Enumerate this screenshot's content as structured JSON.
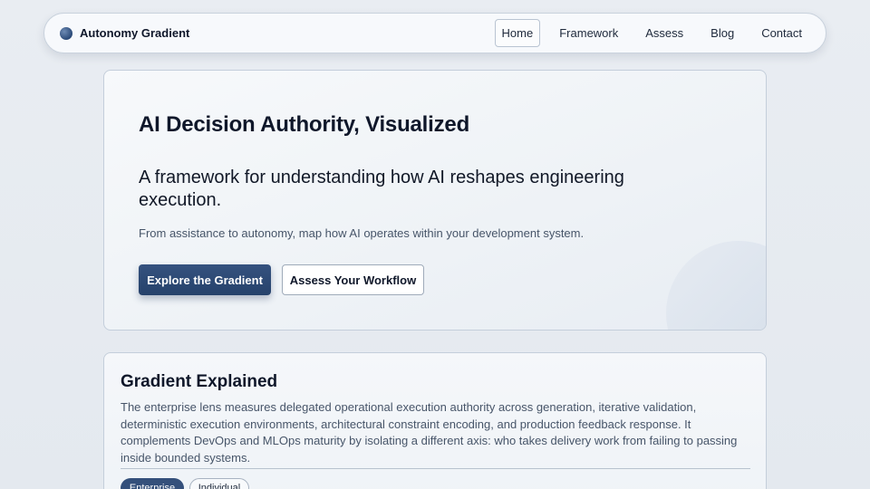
{
  "nav": {
    "brand": "Autonomy Gradient",
    "links": [
      {
        "label": "Home",
        "active": true
      },
      {
        "label": "Framework",
        "active": false
      },
      {
        "label": "Assess",
        "active": false
      },
      {
        "label": "Blog",
        "active": false
      },
      {
        "label": "Contact",
        "active": false
      }
    ]
  },
  "hero": {
    "title": "AI Decision Authority, Visualized",
    "subtitle": "A framework for understanding how AI reshapes engineering execution.",
    "description": "From assistance to autonomy, map how AI operates within your development system.",
    "primary_button": "Explore the Gradient",
    "secondary_button": "Assess Your Workflow"
  },
  "explained": {
    "title": "Gradient Explained",
    "body": "The enterprise lens measures delegated operational execution authority across generation, iterative validation, deterministic execution environments, architectural constraint encoding, and production feedback response. It complements DevOps and MLOps maturity by isolating a different axis: who takes delivery work from failing to passing inside bounded systems.",
    "tabs": [
      {
        "label": "Enterprise",
        "active": true
      },
      {
        "label": "Individual",
        "active": false
      }
    ]
  },
  "colors": {
    "primary": "#2b4a78",
    "text": "#0f172a",
    "muted": "#475569"
  }
}
